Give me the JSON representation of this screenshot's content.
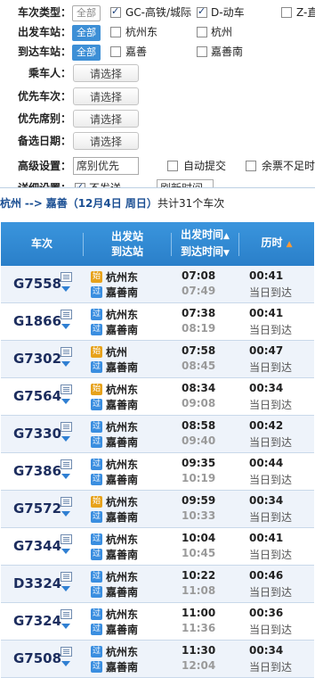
{
  "filters": {
    "train_type": {
      "label": "车次类型：",
      "all_label": "全部",
      "options": [
        {
          "label": "GC-高铁/城际",
          "checked": true
        },
        {
          "label": "D-动车",
          "checked": true
        },
        {
          "label": "Z-直",
          "checked": false
        }
      ]
    },
    "from_station": {
      "label": "出发车站：",
      "all_label": "全部",
      "options": [
        {
          "label": "杭州东",
          "checked": false
        },
        {
          "label": "杭州",
          "checked": false
        }
      ]
    },
    "to_station": {
      "label": "到达车站：",
      "all_label": "全部",
      "options": [
        {
          "label": "嘉善",
          "checked": false
        },
        {
          "label": "嘉善南",
          "checked": false
        }
      ]
    },
    "passenger": {
      "label": "乘车人：",
      "button": "请选择"
    },
    "preferred_train": {
      "label": "优先车次：",
      "button": "请选择"
    },
    "preferred_seat": {
      "label": "优先席别：",
      "button": "请选择"
    },
    "alt_date": {
      "label": "备选日期：",
      "button": "请选择"
    },
    "advanced": {
      "label": "高级设置：",
      "select_value": "席别优先",
      "auto_submit": "自动提交",
      "insufficient": "余票不足时"
    },
    "detail": {
      "label": "详细设置：",
      "cut_text": "不发送",
      "cut_value": "刷新时间"
    }
  },
  "route": {
    "from": "杭州",
    "arrow": "-->",
    "to": "嘉善",
    "date": "（12月4日 周日）",
    "summary": "共计31个车次"
  },
  "table": {
    "headers": {
      "train": "车次",
      "from": "出发站",
      "to": "到达站",
      "dep_time": "出发时间",
      "arr_time": "到达时间",
      "duration": "历时"
    },
    "rows": [
      {
        "train": "G7558",
        "from_badge": "始",
        "from": "杭州东",
        "to_badge": "过",
        "to": "嘉善南",
        "dep": "07:08",
        "arr": "07:49",
        "dur": "00:41",
        "day": "当日到达"
      },
      {
        "train": "G1866",
        "from_badge": "过",
        "from": "杭州东",
        "to_badge": "过",
        "to": "嘉善南",
        "dep": "07:38",
        "arr": "08:19",
        "dur": "00:41",
        "day": "当日到达"
      },
      {
        "train": "G7302",
        "from_badge": "始",
        "from": "杭州",
        "to_badge": "过",
        "to": "嘉善南",
        "dep": "07:58",
        "arr": "08:45",
        "dur": "00:47",
        "day": "当日到达"
      },
      {
        "train": "G7564",
        "from_badge": "始",
        "from": "杭州东",
        "to_badge": "过",
        "to": "嘉善南",
        "dep": "08:34",
        "arr": "09:08",
        "dur": "00:34",
        "day": "当日到达"
      },
      {
        "train": "G7330",
        "from_badge": "过",
        "from": "杭州东",
        "to_badge": "过",
        "to": "嘉善南",
        "dep": "08:58",
        "arr": "09:40",
        "dur": "00:42",
        "day": "当日到达"
      },
      {
        "train": "G7386",
        "from_badge": "过",
        "from": "杭州东",
        "to_badge": "过",
        "to": "嘉善南",
        "dep": "09:35",
        "arr": "10:19",
        "dur": "00:44",
        "day": "当日到达"
      },
      {
        "train": "G7572",
        "from_badge": "始",
        "from": "杭州东",
        "to_badge": "过",
        "to": "嘉善南",
        "dep": "09:59",
        "arr": "10:33",
        "dur": "00:34",
        "day": "当日到达"
      },
      {
        "train": "G7344",
        "from_badge": "过",
        "from": "杭州东",
        "to_badge": "过",
        "to": "嘉善南",
        "dep": "10:04",
        "arr": "10:45",
        "dur": "00:41",
        "day": "当日到达"
      },
      {
        "train": "D3324",
        "from_badge": "过",
        "from": "杭州东",
        "to_badge": "过",
        "to": "嘉善南",
        "dep": "10:22",
        "arr": "11:08",
        "dur": "00:46",
        "day": "当日到达"
      },
      {
        "train": "G7324",
        "from_badge": "过",
        "from": "杭州东",
        "to_badge": "过",
        "to": "嘉善南",
        "dep": "11:00",
        "arr": "11:36",
        "dur": "00:36",
        "day": "当日到达"
      },
      {
        "train": "G7508",
        "from_badge": "过",
        "from": "杭州东",
        "to_badge": "过",
        "to": "嘉善南",
        "dep": "11:30",
        "arr": "12:04",
        "dur": "00:34",
        "day": "当日到达"
      }
    ]
  }
}
